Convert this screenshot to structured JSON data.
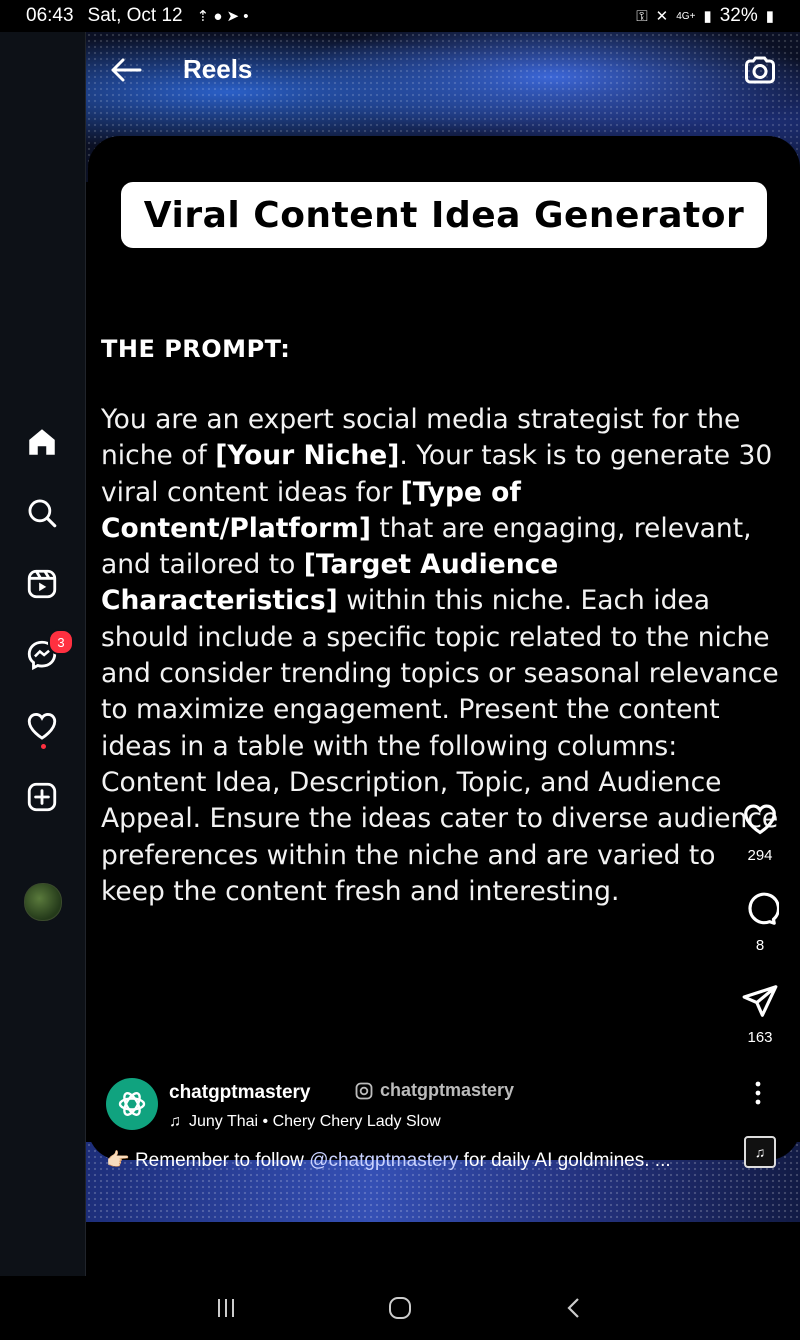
{
  "status_bar": {
    "time": "06:43",
    "date": "Sat, Oct 12",
    "network": "4G+",
    "battery": "32%"
  },
  "header": {
    "title": "Reels"
  },
  "reel": {
    "title_card": "Viral Content Idea Generator",
    "prompt_heading": "THE PROMPT:",
    "prompt_parts": [
      "You are an expert social media strategist for the niche of ",
      "[Your Niche]",
      ". Your task is to generate 30 viral content ideas for ",
      "[Type of Content/Platform]",
      " that are engaging, relevant, and tailored to ",
      "[Target Audience Characteristics]",
      " within this niche. Each idea should include a specific topic related to the niche and consider trending topics or seasonal relevance to maximize engagement. Present the content ideas in a table with the following columns: Content Idea, Description, Topic, and Audience Appeal. Ensure the ideas cater to diverse audience preferences within the niche and are varied to keep the content fresh and interesting."
    ],
    "likes": "294",
    "comments": "8",
    "shares": "163",
    "author": "chatgptmastery",
    "watermark": "chatgptmastery",
    "audio": "Juny Thai • Chery Chery Lady Slow",
    "caption_emoji": "👉🏻",
    "caption_prefix": "Remember to follow ",
    "caption_mention": "@chatgptmastery",
    "caption_suffix": " for daily AI goldmines. ..."
  },
  "sidebar": {
    "messages_badge": "3"
  },
  "colors": {
    "badge": "#ff3040",
    "chatgpt_green": "#10a37f"
  }
}
